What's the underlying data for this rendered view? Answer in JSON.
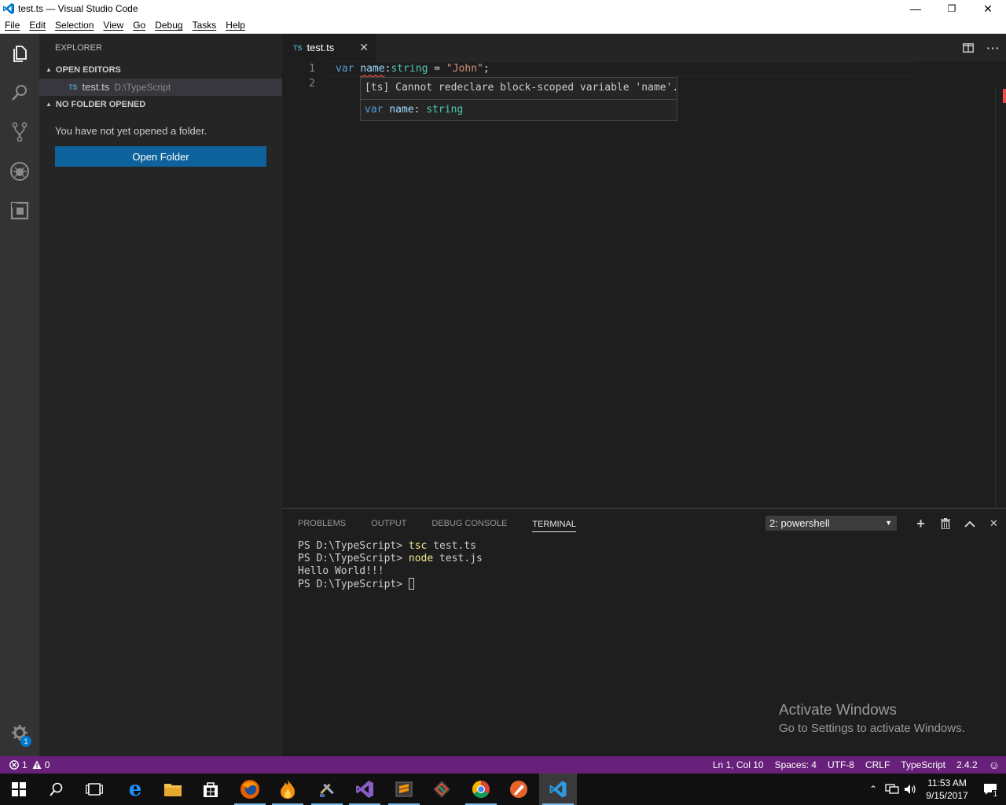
{
  "window": {
    "title": "test.ts — Visual Studio Code",
    "minimize": "—",
    "restore": "❐",
    "close": "✕"
  },
  "menu": [
    "File",
    "Edit",
    "Selection",
    "View",
    "Go",
    "Debug",
    "Tasks",
    "Help"
  ],
  "sidebar": {
    "title": "EXPLORER",
    "open_editors_header": "OPEN EDITORS",
    "open_editor": {
      "icon": "TS",
      "name": "test.ts",
      "path": "D:\\TypeScript"
    },
    "no_folder_header": "NO FOLDER OPENED",
    "no_folder_message": "You have not yet opened a folder.",
    "open_folder_button": "Open Folder"
  },
  "editor": {
    "tab": {
      "icon": "TS",
      "name": "test.ts",
      "close": "✕"
    },
    "lines": [
      {
        "number": "1",
        "tokens": [
          {
            "text": "var",
            "cls": "kw"
          },
          {
            "text": " ",
            "cls": ""
          },
          {
            "text": "name",
            "cls": "var squiggle"
          },
          {
            "text": ":",
            "cls": ""
          },
          {
            "text": "string",
            "cls": "type"
          },
          {
            "text": " = ",
            "cls": ""
          },
          {
            "text": "\"John\"",
            "cls": "str"
          },
          {
            "text": ";",
            "cls": ""
          }
        ]
      },
      {
        "number": "2",
        "tokens": []
      }
    ],
    "hover": {
      "message": "[ts] Cannot redeclare block-scoped variable 'name'.",
      "sig_kw": "var",
      "sig_name": "name",
      "sig_colon": ":",
      "sig_type": "string"
    }
  },
  "panel": {
    "tabs": [
      "PROBLEMS",
      "OUTPUT",
      "DEBUG CONSOLE",
      "TERMINAL"
    ],
    "active_tab": "TERMINAL",
    "terminal_select": "2: powershell",
    "terminal": {
      "prompt": "PS D:\\TypeScript>",
      "line1_cmd": "tsc",
      "line1_arg": "test.ts",
      "line2_cmd": "node",
      "line2_arg": "test.js",
      "line3": "Hello World!!!"
    }
  },
  "watermark": {
    "line1": "Activate Windows",
    "line2": "Go to Settings to activate Windows."
  },
  "statusbar": {
    "errors": "1",
    "warnings": "0",
    "position": "Ln 1, Col 10",
    "spaces": "Spaces: 4",
    "encoding": "UTF-8",
    "eol": "CRLF",
    "language": "TypeScript",
    "version": "2.4.2"
  },
  "activity": {
    "settings_badge": "1"
  },
  "taskbar": {
    "time": "11:53 AM",
    "date": "9/15/2017",
    "notif_count": "1"
  },
  "colors": {
    "accent": "#007acc",
    "statusbar": "#68217a",
    "button": "#0e639c"
  }
}
